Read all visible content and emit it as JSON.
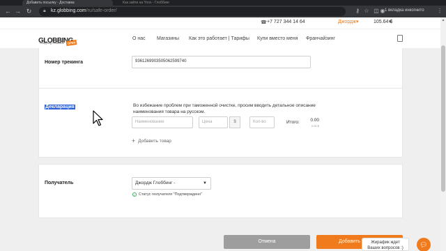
{
  "browser": {
    "tabs": [
      {
        "title": "Добавить посылку - Доставка"
      },
      {
        "title": "Как зайти на Yoox - Глоббинг"
      }
    ],
    "url_host": "kz.globbing.com",
    "url_path": "/ru/safe-order/",
    "incognito_text": "1 вкладка инкогнито"
  },
  "topbar": {
    "phone": "+7 727 344 14 64",
    "user": "Джордж",
    "balance": "105.64 $"
  },
  "header": {
    "logo_text": "GLOBBING",
    "logo_sub": "Shopping Solutions",
    "logo_badge": "OPEN",
    "nav": [
      "О нас",
      "Магазины",
      "Как это работает | Тарифы",
      "Купи вместо меня",
      "Франчайзинг"
    ]
  },
  "tracking": {
    "label": "Номер трекинга",
    "value": "9361269903505062599740"
  },
  "declaration": {
    "label": "Декларация",
    "description": "Во избежание проблем при таможенной очистке, просим вводить детальное описание наименования товара на русском.",
    "name_placeholder": "Наименование",
    "price_placeholder": "Цена",
    "currency": "$",
    "qty_placeholder": "Кол-во",
    "total_label": "Итого:",
    "total_value": "0.00",
    "total_small": "0.00 $",
    "add_item": "Добавить товар"
  },
  "recipient": {
    "label": "Получатель",
    "selected": "Джордж Глоббинг -",
    "status": "Статус получателя \"Подтверждено\""
  },
  "actions": {
    "cancel": "Отмена",
    "add": "Добавить"
  },
  "chat": {
    "line1": "Жирафик ждет",
    "line2": "Ваших вопросов :)"
  },
  "colors": {
    "accent": "#f07b1d",
    "selection": "#2d5fd6",
    "status_ok": "#3aaa5d"
  }
}
